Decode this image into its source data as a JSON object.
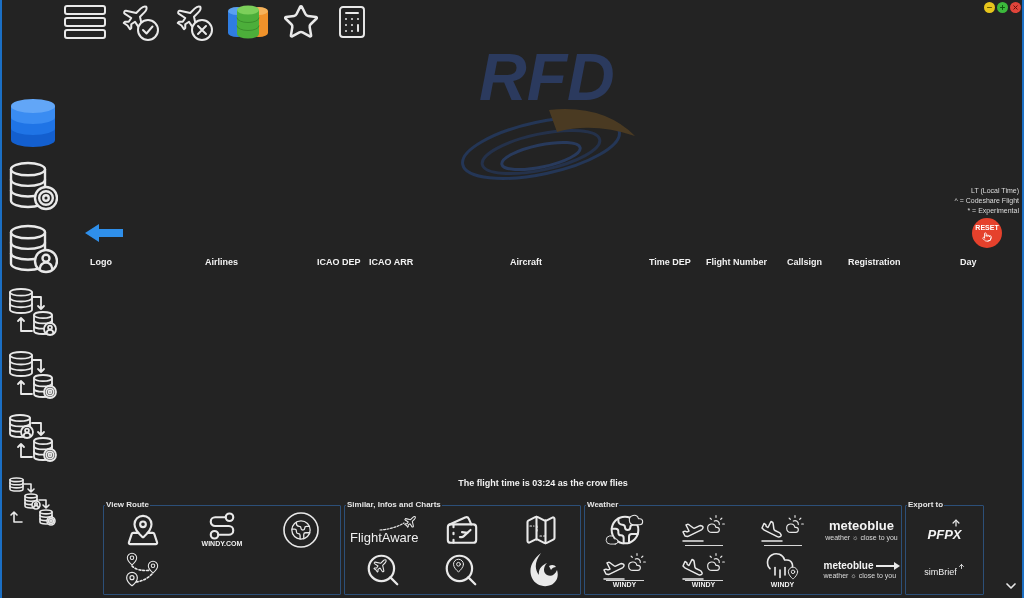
{
  "background_logo": {
    "text": "RFD"
  },
  "legend": [
    "LT (Local Time)",
    "^ = Codeshare Flight",
    "* = Experimental"
  ],
  "reset_button": {
    "label": "RESET"
  },
  "table": {
    "columns": [
      "Logo",
      "Airlines",
      "ICAO DEP",
      "ICAO ARR",
      "Aircraft",
      "Time DEP",
      "Flight Number",
      "Callsign",
      "Registration",
      "Day"
    ]
  },
  "flight_time": "The flight time is 03:24 as the crow flies",
  "panels": [
    {
      "title": "View Route",
      "items": [
        {
          "kind": "map-pins"
        },
        {
          "kind": "route",
          "caption": "WINDY.COM"
        },
        {
          "kind": "globe"
        },
        {
          "kind": "route-pins"
        }
      ]
    },
    {
      "title": "Similar, Infos and Charts",
      "items": [
        {
          "kind": "flightaware",
          "label": "FlightAware"
        },
        {
          "kind": "ticket"
        },
        {
          "kind": "folded-map"
        },
        {
          "kind": "search-plane"
        },
        {
          "kind": "search-pin"
        },
        {
          "kind": "flame"
        }
      ]
    },
    {
      "title": "Weather",
      "items": [
        {
          "kind": "globe-clouds"
        },
        {
          "kind": "takeoff-weather"
        },
        {
          "kind": "landing-weather"
        },
        {
          "kind": "meteoblue",
          "label": "meteoblue",
          "tagline": "weather ☼ close to you"
        },
        {
          "kind": "takeoff-weather",
          "caption": "WINDY"
        },
        {
          "kind": "landing-weather",
          "caption": "WINDY"
        },
        {
          "kind": "rain-pin",
          "caption": "WINDY"
        },
        {
          "kind": "meteoblue-arrow",
          "label": "meteoblue",
          "tagline": "weather ☼ close to you"
        }
      ]
    },
    {
      "title": "Export to",
      "items": [
        {
          "kind": "pfpx",
          "label": "PFPX"
        },
        {
          "kind": "simbrief",
          "label": "simBrief"
        }
      ]
    }
  ]
}
